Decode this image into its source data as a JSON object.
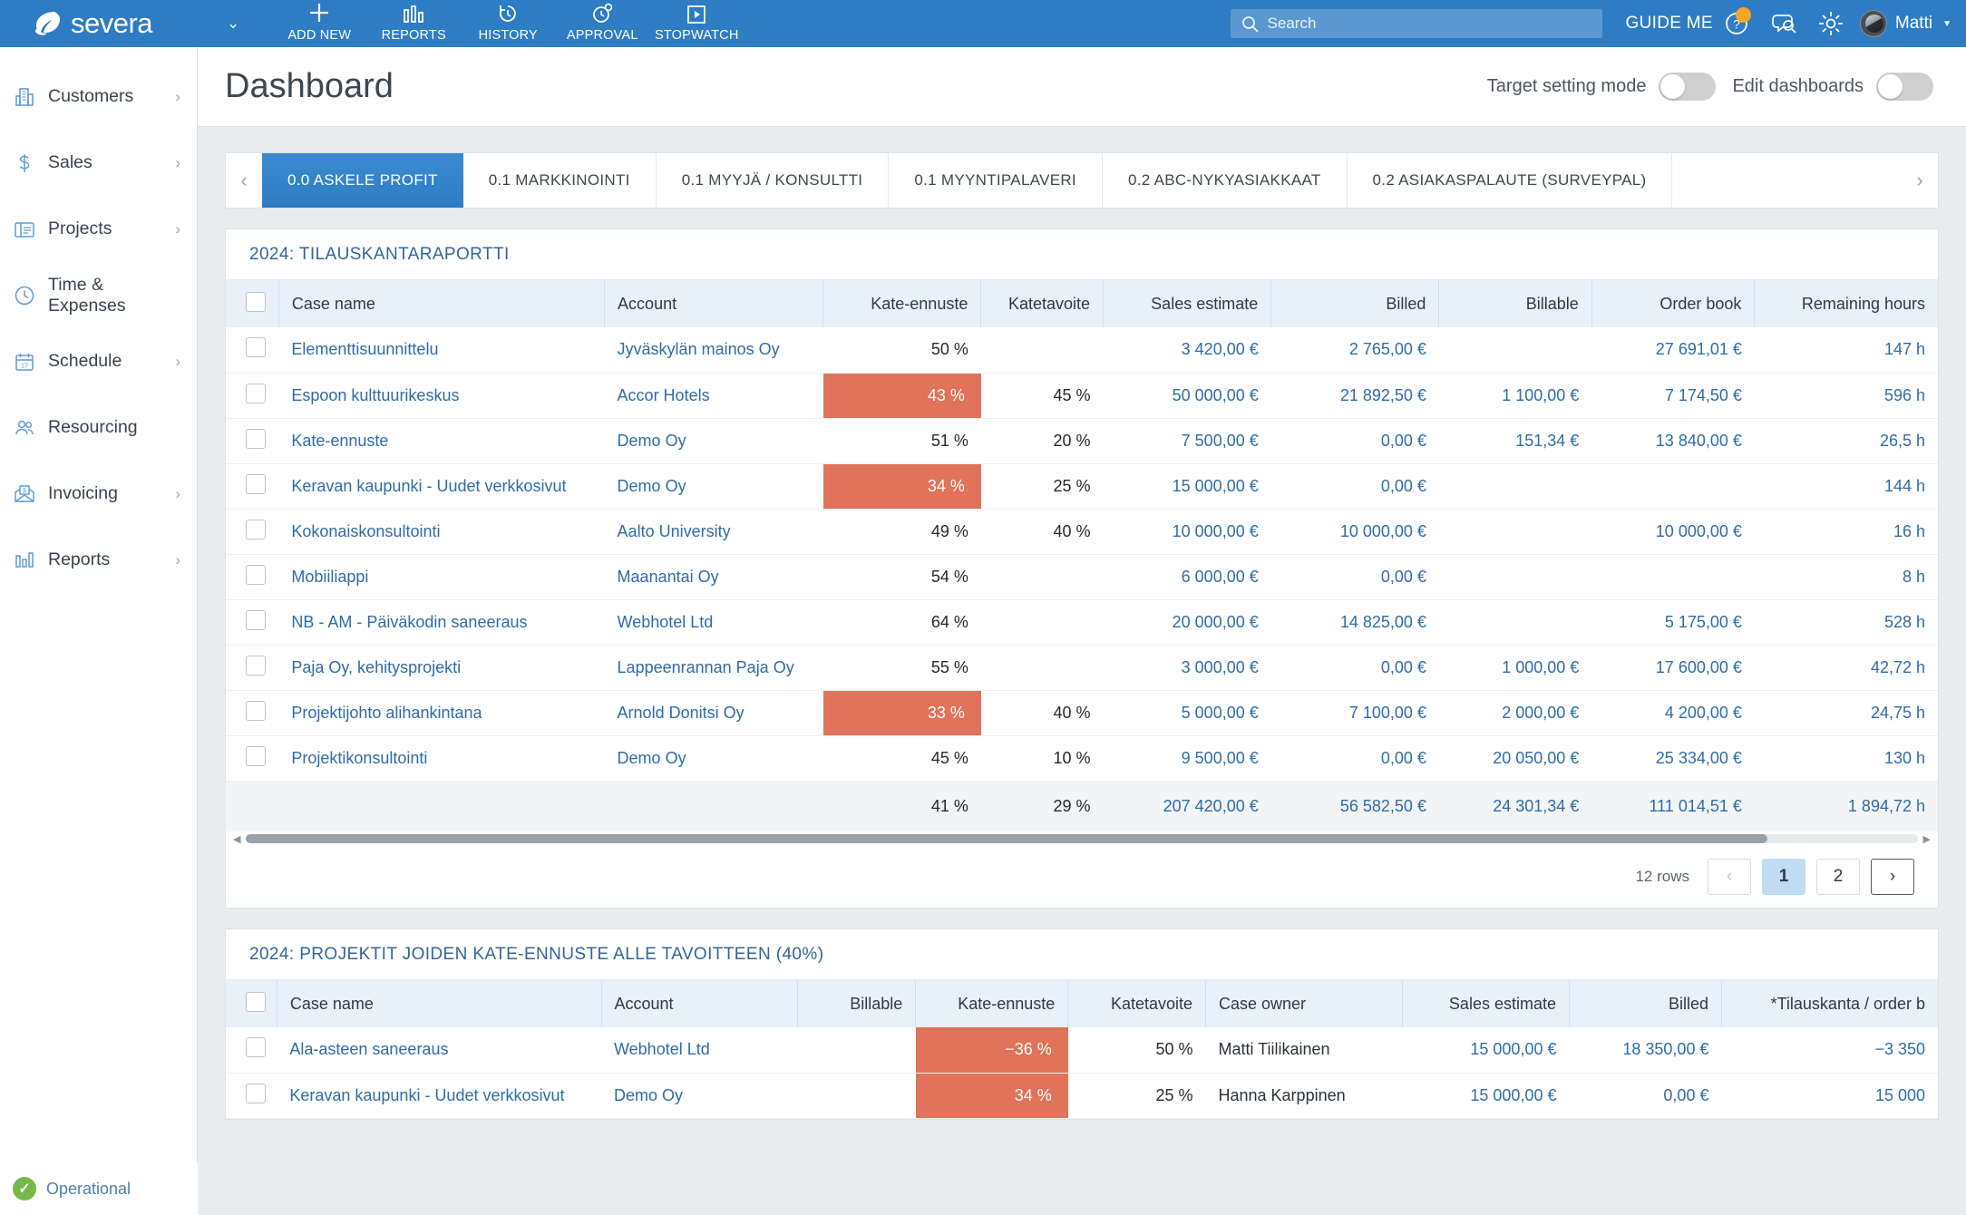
{
  "topbar": {
    "brand": "severa",
    "brand_caret_icon": "chevron-down-icon",
    "actions": [
      {
        "label": "ADD NEW",
        "icon": "plus-icon"
      },
      {
        "label": "REPORTS",
        "icon": "bar-chart-icon"
      },
      {
        "label": "HISTORY",
        "icon": "clock-back-icon"
      },
      {
        "label": "APPROVAL",
        "icon": "clock-check-icon"
      },
      {
        "label": "STOPWATCH",
        "icon": "play-box-icon"
      }
    ],
    "search_placeholder": "Search",
    "search_value": "",
    "guide_me": "GUIDE ME",
    "help_icon": "question-circle-icon",
    "chat_icon": "chat-search-icon",
    "settings_icon": "gear-icon",
    "user_name": "Matti",
    "user_caret_icon": "caret-down-icon",
    "accent": "#2e7cc4",
    "badge_color": "#f5a623"
  },
  "sidebar": {
    "items": [
      {
        "label": "Customers",
        "icon": "building-icon",
        "has_arrow": true
      },
      {
        "label": "Sales",
        "icon": "dollar-icon",
        "has_arrow": true
      },
      {
        "label": "Projects",
        "icon": "folder-list-icon",
        "has_arrow": true
      },
      {
        "label": "Time & Expenses",
        "icon": "clock-icon",
        "has_arrow": false
      },
      {
        "label": "Schedule",
        "icon": "calendar-icon",
        "has_arrow": true
      },
      {
        "label": "Resourcing",
        "icon": "people-icon",
        "has_arrow": false
      },
      {
        "label": "Invoicing",
        "icon": "invoice-envelope-icon",
        "has_arrow": true
      },
      {
        "label": "Reports",
        "icon": "bar-chart-icon",
        "has_arrow": true
      }
    ],
    "status": {
      "label": "Operational",
      "icon": "check-circle-icon",
      "color": "#76b94b"
    }
  },
  "page": {
    "title": "Dashboard",
    "controls": [
      {
        "label": "Target setting mode",
        "state": "off"
      },
      {
        "label": "Edit dashboards",
        "state": "off"
      }
    ]
  },
  "tabs": {
    "prev_icon": "chevron-left-icon",
    "next_icon": "chevron-right-icon",
    "items": [
      {
        "label": "0.0 ASKELE PROFIT",
        "active": true
      },
      {
        "label": "0.1 MARKKINOINTI",
        "active": false
      },
      {
        "label": "0.1 MYYJÄ / KONSULTTI",
        "active": false
      },
      {
        "label": "0.1 MYYNTIPALAVERI",
        "active": false
      },
      {
        "label": "0.2 ABC-NYKYASIAKKAAT",
        "active": false
      },
      {
        "label": "0.2 ASIAKASPALAUTE (SURVEYPAL)",
        "active": false
      }
    ]
  },
  "widget1": {
    "title": "2024: TILAUSKANTARAPORTTI",
    "columns": [
      "Case name",
      "Account",
      "Kate-ennuste",
      "Katetavoite",
      "Sales estimate",
      "Billed",
      "Billable",
      "Order book",
      "Remaining hours"
    ],
    "rows": [
      {
        "case": "Elementtisuunnittelu",
        "account": "Jyväskylän mainos Oy",
        "kate": "50 %",
        "heat": false,
        "tavoite": "",
        "estimate": "3 420,00 €",
        "billed": "2 765,00 €",
        "billable": "",
        "order": "27 691,01 €",
        "hours": "147 h"
      },
      {
        "case": "Espoon kulttuurikeskus",
        "account": "Accor Hotels",
        "kate": "43 %",
        "heat": true,
        "tavoite": "45 %",
        "estimate": "50 000,00 €",
        "billed": "21 892,50 €",
        "billable": "1 100,00 €",
        "order": "7 174,50 €",
        "hours": "596 h"
      },
      {
        "case": "Kate-ennuste",
        "account": "Demo Oy",
        "kate": "51 %",
        "heat": false,
        "tavoite": "20 %",
        "estimate": "7 500,00 €",
        "billed": "0,00 €",
        "billable": "151,34 €",
        "order": "13 840,00 €",
        "hours": "26,5 h"
      },
      {
        "case": "Keravan kaupunki - Uudet verkkosivut",
        "account": "Demo Oy",
        "kate": "34 %",
        "heat": true,
        "tavoite": "25 %",
        "estimate": "15 000,00 €",
        "billed": "0,00 €",
        "billable": "",
        "order": "",
        "hours": "144 h"
      },
      {
        "case": "Kokonaiskonsultointi",
        "account": "Aalto University",
        "kate": "49 %",
        "heat": false,
        "tavoite": "40 %",
        "estimate": "10 000,00 €",
        "billed": "10 000,00 €",
        "billable": "",
        "order": "10 000,00 €",
        "hours": "16 h"
      },
      {
        "case": "Mobiiliappi",
        "account": "Maanantai Oy",
        "kate": "54 %",
        "heat": false,
        "tavoite": "",
        "estimate": "6 000,00 €",
        "billed": "0,00 €",
        "billable": "",
        "order": "",
        "hours": "8 h"
      },
      {
        "case": "NB - AM - Päiväkodin saneeraus",
        "account": "Webhotel Ltd",
        "kate": "64 %",
        "heat": false,
        "tavoite": "",
        "estimate": "20 000,00 €",
        "billed": "14 825,00 €",
        "billable": "",
        "order": "5 175,00 €",
        "hours": "528 h"
      },
      {
        "case": "Paja Oy, kehitysprojekti",
        "account": "Lappeenrannan Paja Oy",
        "kate": "55 %",
        "heat": false,
        "tavoite": "",
        "estimate": "3 000,00 €",
        "billed": "0,00 €",
        "billable": "1 000,00 €",
        "order": "17 600,00 €",
        "hours": "42,72 h"
      },
      {
        "case": "Projektijohto alihankintana",
        "account": "Arnold Donitsi Oy",
        "kate": "33 %",
        "heat": true,
        "tavoite": "40 %",
        "estimate": "5 000,00 €",
        "billed": "7 100,00 €",
        "billable": "2 000,00 €",
        "order": "4 200,00 €",
        "hours": "24,75 h"
      },
      {
        "case": "Projektikonsultointi",
        "account": "Demo Oy",
        "kate": "45 %",
        "heat": false,
        "tavoite": "10 %",
        "estimate": "9 500,00 €",
        "billed": "0,00 €",
        "billable": "20 050,00 €",
        "order": "25 334,00 €",
        "hours": "130 h"
      }
    ],
    "total": {
      "case": "",
      "account": "",
      "kate": "41 %",
      "tavoite": "29 %",
      "estimate": "207 420,00 €",
      "billed": "56 582,50 €",
      "billable": "24 301,34 €",
      "order": "111 014,51 €",
      "hours": "1 894,72 h"
    },
    "pager": {
      "rows_label": "12 rows",
      "prev_icon": "chevron-left-icon",
      "next_icon": "chevron-right-icon",
      "pages": [
        "1",
        "2"
      ],
      "current": "1"
    }
  },
  "widget2": {
    "title": "2024: PROJEKTIT JOIDEN KATE-ENNUSTE ALLE TAVOITTEEN (40%)",
    "columns": [
      "Case name",
      "Account",
      "Billable",
      "Kate-ennuste",
      "Katetavoite",
      "Case owner",
      "Sales estimate",
      "Billed",
      "*Tilauskanta / order b"
    ],
    "rows": [
      {
        "case": "Ala-asteen saneeraus",
        "account": "Webhotel Ltd",
        "billable": "",
        "kate": "−36 %",
        "heat": true,
        "tavoite": "50 %",
        "owner": "Matti Tiilikainen",
        "estimate": "15 000,00 €",
        "billed": "18 350,00 €",
        "order": "−3 350"
      },
      {
        "case": "Keravan kaupunki - Uudet verkkosivut",
        "account": "Demo Oy",
        "billable": "",
        "kate": "34 %",
        "heat": true,
        "tavoite": "25 %",
        "owner": "Hanna Karppinen",
        "estimate": "15 000,00 €",
        "billed": "0,00 €",
        "order": "15 000"
      }
    ]
  },
  "colors": {
    "heat": "#e0735a",
    "link": "#2f6ca8",
    "header_bg": "#e8f1fa",
    "title": "#336699"
  }
}
